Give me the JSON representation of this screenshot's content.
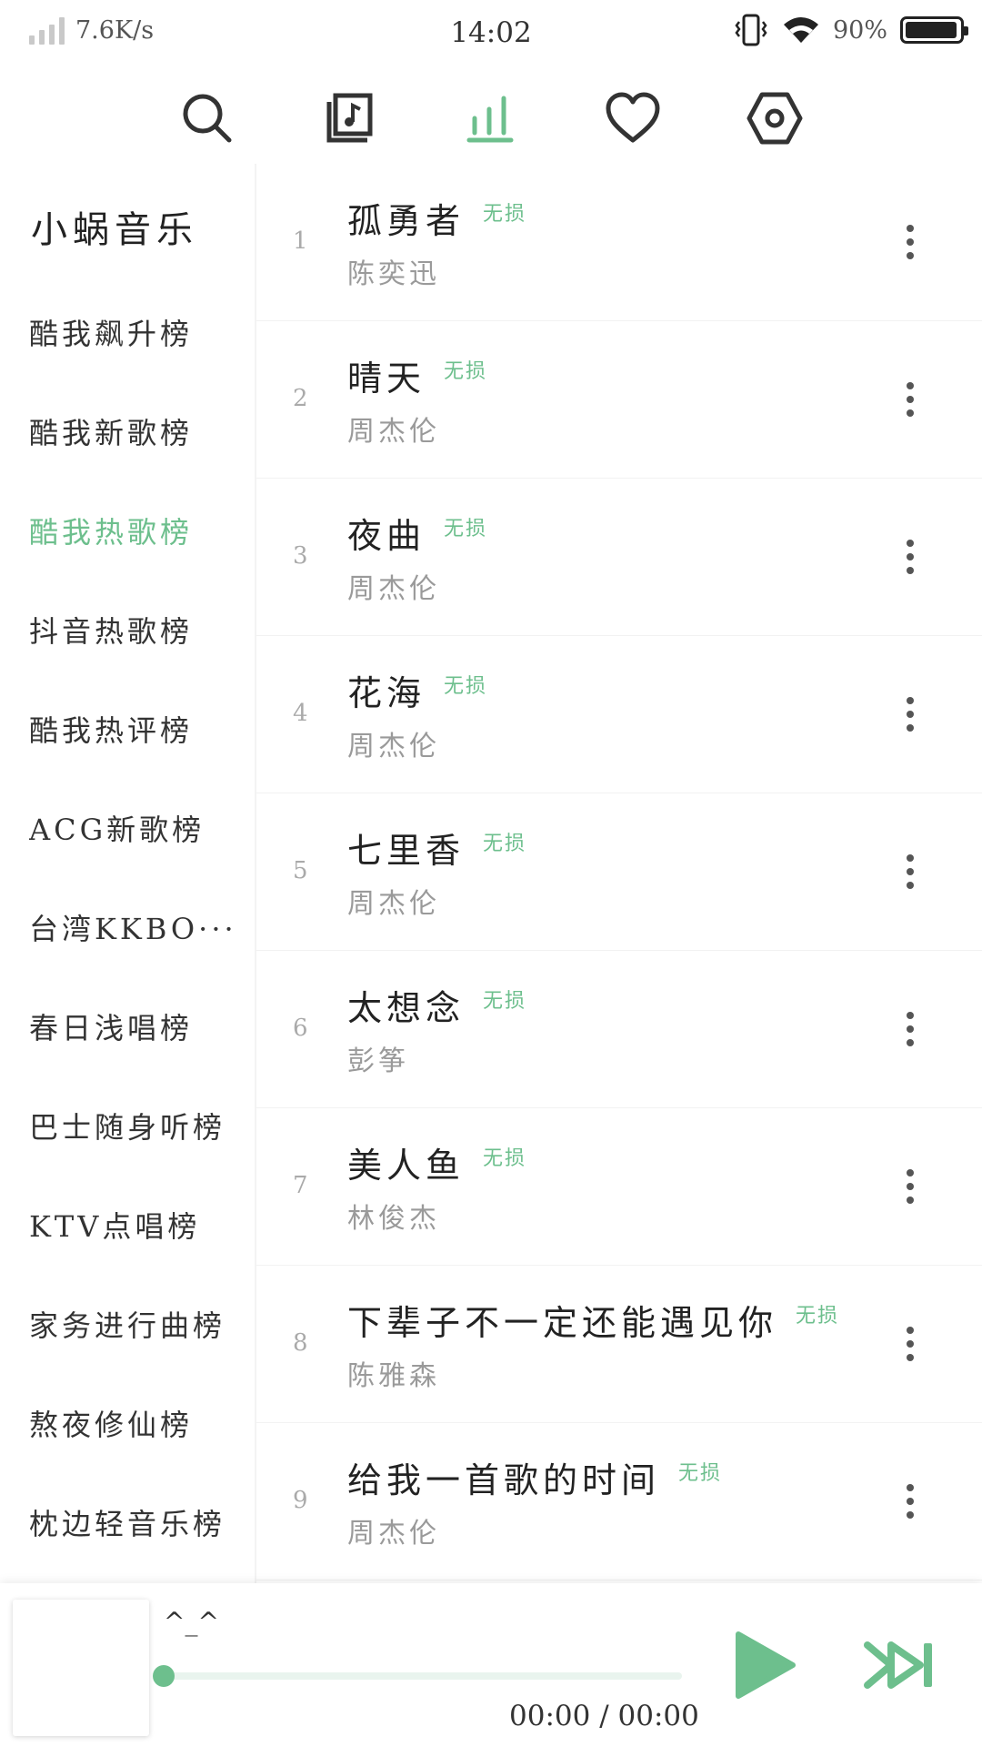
{
  "status_bar": {
    "network_speed": "7.6K/s",
    "time": "14:02",
    "battery": "90%",
    "icons": [
      "signal-icon",
      "vibrate-icon",
      "wifi-icon",
      "battery-icon"
    ]
  },
  "nav": {
    "items": [
      {
        "icon": "search-icon"
      },
      {
        "icon": "music-library-icon"
      },
      {
        "icon": "chart-icon",
        "active": true
      },
      {
        "icon": "heart-icon"
      },
      {
        "icon": "settings-icon"
      }
    ],
    "accent_color": "#6dbf8d"
  },
  "sidebar": {
    "brand": "小蜗音乐",
    "items": [
      {
        "label": "酷我飙升榜"
      },
      {
        "label": "酷我新歌榜"
      },
      {
        "label": "酷我热歌榜",
        "active": true
      },
      {
        "label": "抖音热歌榜"
      },
      {
        "label": "酷我热评榜"
      },
      {
        "label": "ACG新歌榜"
      },
      {
        "label": "台湾KKBO···"
      },
      {
        "label": "春日浅唱榜"
      },
      {
        "label": "巴士随身听榜"
      },
      {
        "label": "KTV点唱榜"
      },
      {
        "label": "家务进行曲榜"
      },
      {
        "label": "熬夜修仙榜"
      },
      {
        "label": "枕边轻音乐榜"
      }
    ]
  },
  "songs": [
    {
      "index": "1",
      "title": "孤勇者",
      "tag": "无损",
      "artist": "陈奕迅"
    },
    {
      "index": "2",
      "title": "晴天",
      "tag": "无损",
      "artist": "周杰伦"
    },
    {
      "index": "3",
      "title": "夜曲",
      "tag": "无损",
      "artist": "周杰伦"
    },
    {
      "index": "4",
      "title": "花海",
      "tag": "无损",
      "artist": "周杰伦"
    },
    {
      "index": "5",
      "title": "七里香",
      "tag": "无损",
      "artist": "周杰伦"
    },
    {
      "index": "6",
      "title": "太想念",
      "tag": "无损",
      "artist": "彭筝"
    },
    {
      "index": "7",
      "title": "美人鱼",
      "tag": "无损",
      "artist": "林俊杰"
    },
    {
      "index": "8",
      "title": "下辈子不一定还能遇见你",
      "tag": "无损",
      "artist": "陈雅森"
    },
    {
      "index": "9",
      "title": "给我一首歌的时间",
      "tag": "无损",
      "artist": "周杰伦"
    }
  ],
  "player": {
    "title": "^_^",
    "current_time": "00:00",
    "separator": "/",
    "total_time": "00:00",
    "progress": 0,
    "icons": [
      "play-icon",
      "next-icon"
    ]
  }
}
